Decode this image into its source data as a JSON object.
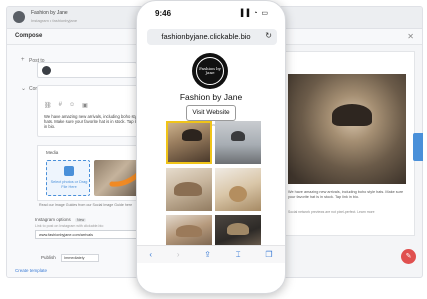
{
  "account": {
    "name": "Fashion by Jane",
    "subtitle": "Instagram • fashionbyjane"
  },
  "composer": {
    "title": "Compose",
    "post_to_label": "Post to",
    "content_label": "Content",
    "content_text": "We have amazing new arrivals, including boho style hats. Make sure your favorite hat is in stock. Tap link in bio.",
    "media_label": "Media",
    "upload_text": "Select photos or Drag File Here",
    "media_note": "Read our Image Guides from our Social Image Guide here",
    "ig_options_title": "Instagram options",
    "ig_badge": "New",
    "ig_sub": "Link to post on Instagram with clickable.bio",
    "ig_link": "www.fashionbyjane.com/arrivals",
    "publish_label": "Publish",
    "publish_value": "Immediately",
    "create_template": "Create template"
  },
  "preview": {
    "caption": "We have amazing new arrivals, including boho style hats. Make sure your favorite hat is in stock. Tap link in bio.",
    "note": "Social network previews are not pixel-perfect. Learn more"
  },
  "phone": {
    "time": "9:46",
    "status_icons": "▐▐ ◔ ▭",
    "url": "fashionbyjane.clickable.bio",
    "reload_glyph": "↻",
    "logo_text": "Fashion by Jane",
    "profile_name": "Fashion by Jane",
    "visit_button": "Visit Website",
    "tap_hint": "Tap on the images below",
    "nav": [
      "‹",
      "›",
      "⇪",
      "⌶",
      "❐"
    ]
  },
  "colors": {
    "accent_orange": "#f08a24",
    "highlight_yellow": "#f0c419",
    "link_blue": "#3a7bd5",
    "fab_red": "#e0504f"
  },
  "icons": {
    "arrow": "curved-arrow-icon",
    "close": "close-icon",
    "reload": "reload-icon",
    "edit": "pencil-icon"
  }
}
